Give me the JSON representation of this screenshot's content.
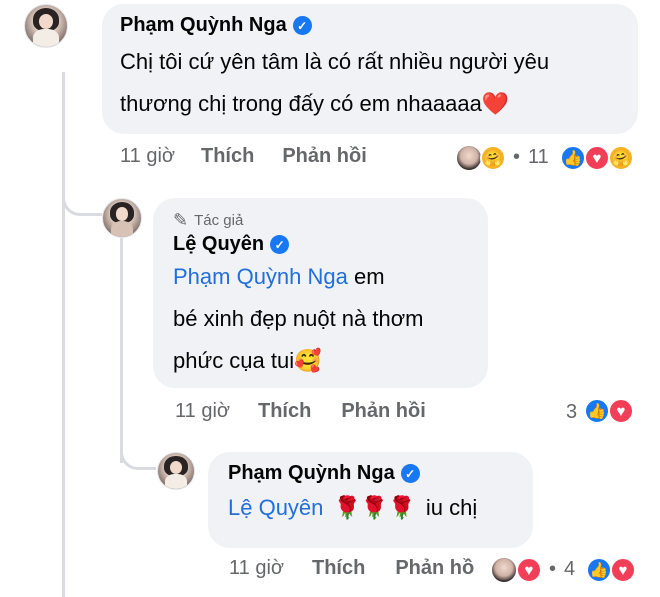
{
  "comment1": {
    "author": "Phạm Quỳnh Nga",
    "text_line1": "Chị tôi cứ yên tâm là có rất nhiều người yêu",
    "text_line2": "thương chị trong đấy có em nhaaaaa",
    "emoji": "❤️",
    "time": "11 giờ",
    "like_label": "Thích",
    "reply_label": "Phản hồi",
    "reaction_dot": "•",
    "reaction_count": "11"
  },
  "comment2": {
    "author_tag": "Tác giả",
    "author": "Lệ Quyên",
    "mention": "Phạm Quỳnh Nga",
    "text_after_mention": " em",
    "text_line2": "bé xinh đẹp nuột nà thơm",
    "text_line3": "phức cụa tui",
    "emoji": "🥰",
    "time": "11 giờ",
    "like_label": "Thích",
    "reply_label": "Phản hồi",
    "reaction_count": "3"
  },
  "comment3": {
    "author": "Phạm Quỳnh Nga",
    "mention": "Lệ Quyên",
    "roses": "🌹🌹🌹",
    "text_after": "iu chị",
    "time": "11 giờ",
    "like_label": "Thích",
    "reply_label": "Phản hồ",
    "reaction_dot": "•",
    "reaction_count": "4"
  },
  "icons": {
    "verified": "✓",
    "pencil": "✎",
    "like": "👍",
    "love": "♥",
    "care": "🤗"
  }
}
